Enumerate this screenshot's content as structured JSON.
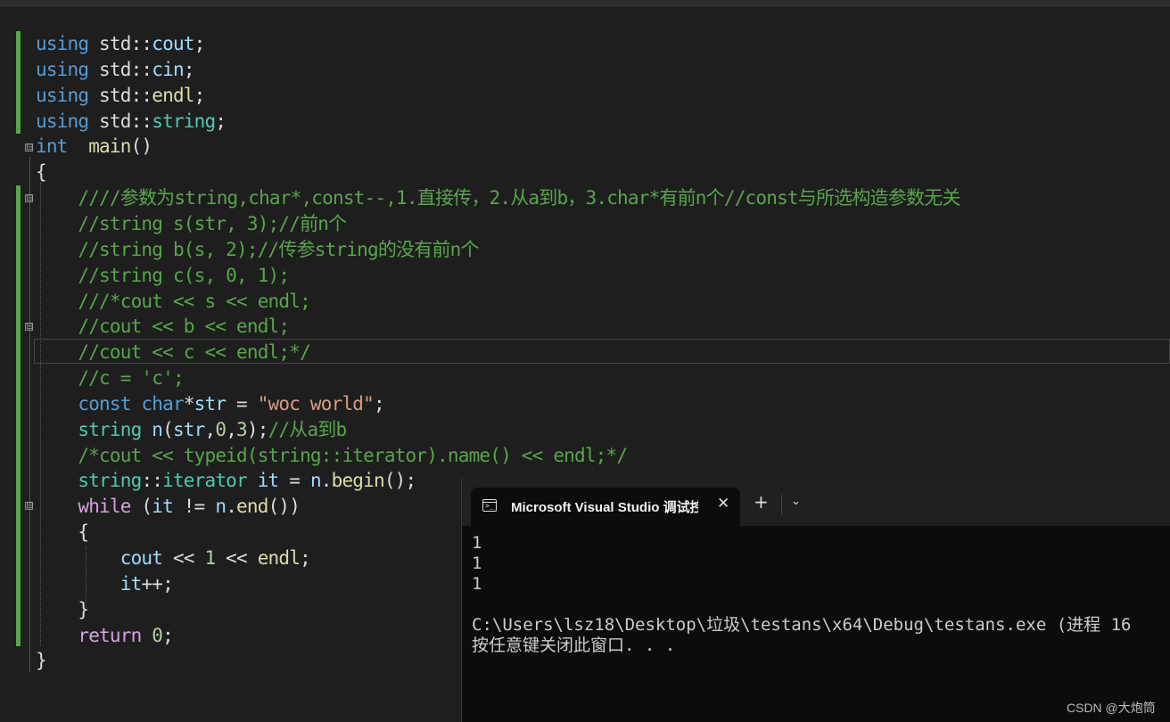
{
  "editor": {
    "lines": [
      {
        "tokens": [
          {
            "t": "using",
            "c": "kw"
          },
          {
            "t": " std::"
          },
          {
            "t": "cout",
            "c": "var"
          },
          {
            "t": ";"
          }
        ]
      },
      {
        "tokens": [
          {
            "t": "using",
            "c": "kw"
          },
          {
            "t": " std::"
          },
          {
            "t": "cin",
            "c": "var"
          },
          {
            "t": ";"
          }
        ]
      },
      {
        "tokens": [
          {
            "t": "using",
            "c": "kw"
          },
          {
            "t": " std::"
          },
          {
            "t": "endl",
            "c": "fn"
          },
          {
            "t": ";"
          }
        ]
      },
      {
        "tokens": [
          {
            "t": "using",
            "c": "kw"
          },
          {
            "t": " std::"
          },
          {
            "t": "string",
            "c": "ty"
          },
          {
            "t": ";"
          }
        ]
      },
      {
        "tokens": [
          {
            "t": "int",
            "c": "kw"
          },
          {
            "t": "  "
          },
          {
            "t": "main",
            "c": "fn"
          },
          {
            "t": "()"
          }
        ]
      },
      {
        "tokens": [
          {
            "t": "{"
          }
        ]
      },
      {
        "tokens": [
          {
            "t": "    "
          },
          {
            "t": "////参数为string,char*,const--,1.直接传，2.从a到b，3.char*有前n个//const与所选构造参数无关",
            "c": "cm"
          }
        ]
      },
      {
        "tokens": [
          {
            "t": "    "
          },
          {
            "t": "//string s(str, 3);//前n个",
            "c": "cm"
          }
        ]
      },
      {
        "tokens": [
          {
            "t": "    "
          },
          {
            "t": "//string b(s, 2);//传参string的没有前n个",
            "c": "cm"
          }
        ]
      },
      {
        "tokens": [
          {
            "t": "    "
          },
          {
            "t": "//string c(s, 0, 1);",
            "c": "cm"
          }
        ]
      },
      {
        "tokens": [
          {
            "t": "    "
          },
          {
            "t": "///*cout << s << endl;",
            "c": "cm"
          }
        ]
      },
      {
        "tokens": [
          {
            "t": "    "
          },
          {
            "t": "//cout << b << endl;",
            "c": "cm"
          }
        ]
      },
      {
        "tokens": [
          {
            "t": "    "
          },
          {
            "t": "//cout << c << endl;*/",
            "c": "cm"
          }
        ]
      },
      {
        "tokens": [
          {
            "t": "    "
          },
          {
            "t": "//c = 'c';",
            "c": "cm"
          }
        ]
      },
      {
        "tokens": [
          {
            "t": "    "
          },
          {
            "t": "const",
            "c": "kw"
          },
          {
            "t": " "
          },
          {
            "t": "char",
            "c": "kw"
          },
          {
            "t": "*"
          },
          {
            "t": "str",
            "c": "var"
          },
          {
            "t": " = "
          },
          {
            "t": "\"woc world\"",
            "c": "str"
          },
          {
            "t": ";"
          }
        ]
      },
      {
        "tokens": [
          {
            "t": "    "
          },
          {
            "t": "string",
            "c": "ty"
          },
          {
            "t": " "
          },
          {
            "t": "n",
            "c": "var"
          },
          {
            "t": "("
          },
          {
            "t": "str",
            "c": "var"
          },
          {
            "t": ","
          },
          {
            "t": "0",
            "c": "num"
          },
          {
            "t": ","
          },
          {
            "t": "3",
            "c": "num"
          },
          {
            "t": ");"
          },
          {
            "t": "//从a到b",
            "c": "cm"
          }
        ]
      },
      {
        "tokens": [
          {
            "t": "    "
          },
          {
            "t": "/*cout << typeid(string::iterator).name() << endl;*/",
            "c": "cm"
          }
        ]
      },
      {
        "tokens": [
          {
            "t": "    "
          },
          {
            "t": "string",
            "c": "ty"
          },
          {
            "t": "::"
          },
          {
            "t": "iterator",
            "c": "ty"
          },
          {
            "t": " "
          },
          {
            "t": "it",
            "c": "var"
          },
          {
            "t": " = "
          },
          {
            "t": "n",
            "c": "var"
          },
          {
            "t": "."
          },
          {
            "t": "begin",
            "c": "fn"
          },
          {
            "t": "();"
          }
        ]
      },
      {
        "tokens": [
          {
            "t": "    "
          },
          {
            "t": "while",
            "c": "ctl"
          },
          {
            "t": " ("
          },
          {
            "t": "it",
            "c": "var"
          },
          {
            "t": " != "
          },
          {
            "t": "n",
            "c": "var"
          },
          {
            "t": "."
          },
          {
            "t": "end",
            "c": "fn"
          },
          {
            "t": "())"
          }
        ]
      },
      {
        "tokens": [
          {
            "t": "    {"
          }
        ]
      },
      {
        "tokens": [
          {
            "t": "        "
          },
          {
            "t": "cout",
            "c": "var"
          },
          {
            "t": " << "
          },
          {
            "t": "1",
            "c": "num"
          },
          {
            "t": " << "
          },
          {
            "t": "endl",
            "c": "fn"
          },
          {
            "t": ";"
          }
        ]
      },
      {
        "tokens": [
          {
            "t": "        "
          },
          {
            "t": "it",
            "c": "var"
          },
          {
            "t": "++;"
          }
        ]
      },
      {
        "tokens": [
          {
            "t": "    }"
          }
        ]
      },
      {
        "tokens": [
          {
            "t": "    "
          },
          {
            "t": "return",
            "c": "ctl"
          },
          {
            "t": " "
          },
          {
            "t": "0",
            "c": "num"
          },
          {
            "t": ";"
          }
        ]
      },
      {
        "tokens": [
          {
            "t": "}"
          }
        ]
      }
    ],
    "fold_markers": [
      "⊟",
      "⊟",
      "⊟",
      "⊟"
    ]
  },
  "console": {
    "tab_title": "Microsoft Visual Studio 调试控制台",
    "close_glyph": "✕",
    "new_tab_glyph": "+",
    "dropdown_glyph": "⌄",
    "output_lines": [
      "1",
      "1",
      "1",
      "",
      "C:\\Users\\lsz18\\Desktop\\垃圾\\testans\\x64\\Debug\\testans.exe (进程 16",
      "按任意键关闭此窗口. . ."
    ]
  },
  "watermark": "CSDN @大炮筒"
}
